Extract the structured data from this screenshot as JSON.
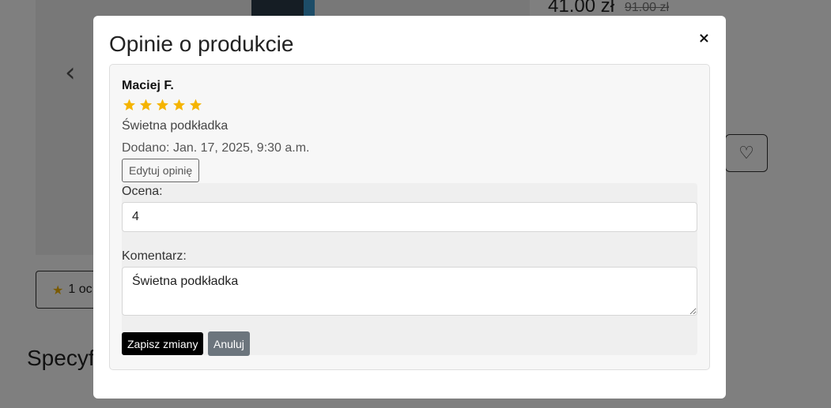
{
  "background": {
    "price": "41.00 zł",
    "old_price": "91.00 zł",
    "rating_button_label": "1 oc",
    "specs_heading": "Specyf",
    "prev_arrow": "‹",
    "fav_icon": "♡",
    "star_icon": "★"
  },
  "modal": {
    "title": "Opinie o produkcie",
    "close_label": "×",
    "review": {
      "author": "Maciej F.",
      "stars": 5,
      "star_color": "#f5b400",
      "text": "Świetna podkładka",
      "date": "Dodano: Jan. 17, 2025, 9:30 a.m.",
      "edit_label": "Edytuj opinię"
    },
    "edit_form": {
      "rating_label": "Ocena:",
      "rating_value": "4",
      "comment_label": "Komentarz:",
      "comment_value": "Świetna podkładka",
      "save_label": "Zapisz zmiany",
      "cancel_label": "Anuluj"
    }
  }
}
